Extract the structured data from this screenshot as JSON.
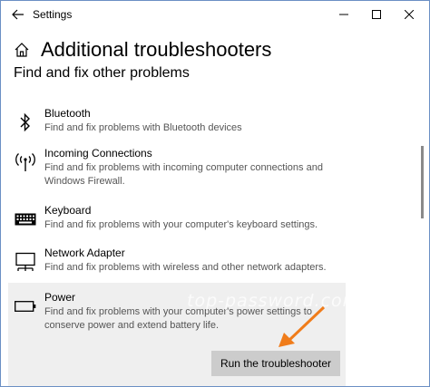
{
  "window": {
    "title": "Settings"
  },
  "page": {
    "title": "Additional troubleshooters",
    "section_title": "Find and fix other problems"
  },
  "items": [
    {
      "name": "Bluetooth",
      "description": "Find and fix problems with Bluetooth devices",
      "icon": "bluetooth-icon"
    },
    {
      "name": "Incoming Connections",
      "description": "Find and fix problems with incoming computer connections and Windows Firewall.",
      "icon": "antenna-icon"
    },
    {
      "name": "Keyboard",
      "description": "Find and fix problems with your computer's keyboard settings.",
      "icon": "keyboard-icon"
    },
    {
      "name": "Network Adapter",
      "description": "Find and fix problems with wireless and other network adapters.",
      "icon": "network-adapter-icon"
    },
    {
      "name": "Power",
      "description": "Find and fix problems with your computer's power settings to conserve power and extend battery life.",
      "icon": "battery-icon",
      "selected": true
    }
  ],
  "actions": {
    "run_label": "Run the troubleshooter"
  },
  "watermark": "top-password.com",
  "colors": {
    "accent_arrow": "#f07c1a",
    "selected_bg": "#efefef",
    "button_bg": "#cccccc"
  }
}
